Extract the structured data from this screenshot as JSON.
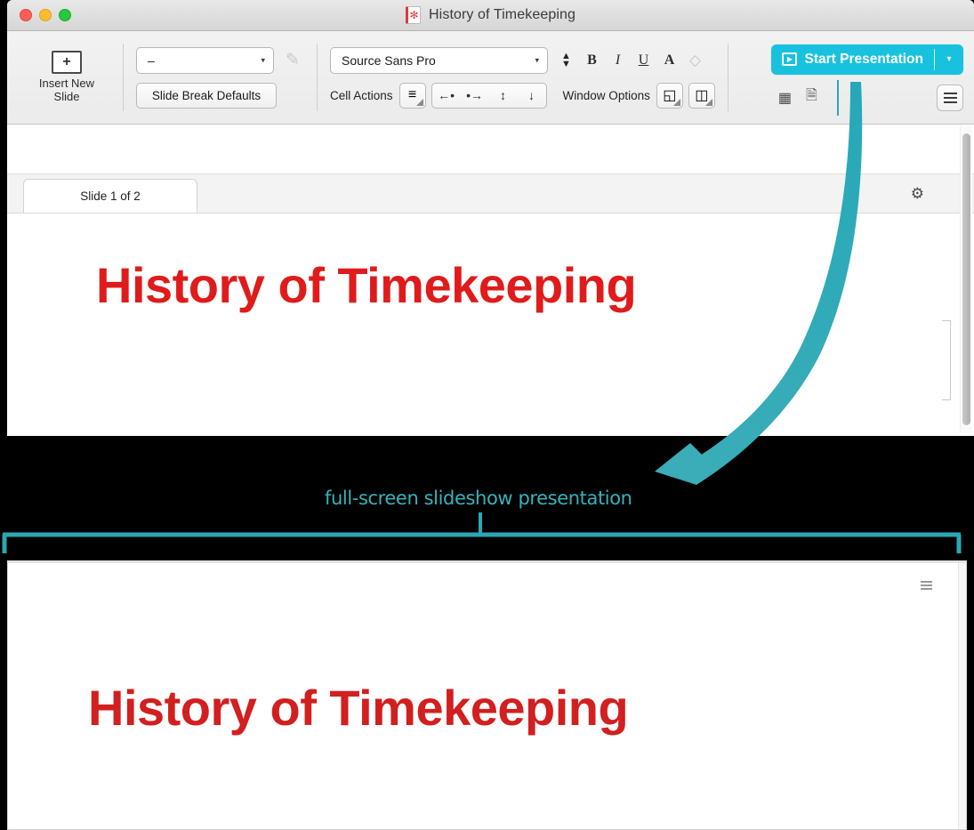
{
  "window": {
    "title": "History of Timekeeping",
    "doc_icon": "document-icon",
    "traffic_lights": {
      "close": "close-button",
      "minimize": "minimize-button",
      "maximize": "maximize-button"
    }
  },
  "toolbar": {
    "insert_slide": {
      "icon": "plus-in-slide-icon",
      "glyph": "+",
      "label_line1": "Insert New",
      "label_line2": "Slide"
    },
    "slide_break": {
      "select_value": "–",
      "caret": "▾",
      "pen_icon": "pen-strike-icon",
      "defaults_button": "Slide Break Defaults"
    },
    "format": {
      "font_value": "Source Sans Pro",
      "caret": "▾",
      "size_stepper": "size-stepper",
      "bold": "B",
      "italic": "I",
      "underline": "U",
      "text_color": "A",
      "clear_format": "◇"
    },
    "cell_actions": {
      "label": "Cell Actions",
      "align_icon": "align-left-icon",
      "buttons": [
        "←•",
        "•→",
        "↑",
        "↓"
      ]
    },
    "window_options": {
      "label": "Window Options",
      "fullscreen_icon": "fullscreen-icon",
      "split_icon": "split-view-icon"
    },
    "start_presentation": {
      "label": "Start Presentation",
      "play_icon": "play-icon",
      "glyph": "▶",
      "caret": "▾",
      "color": "#18c2de"
    },
    "secondary_icons": {
      "grid": "grid-view-icon",
      "notes": "presenter-notes-icon",
      "hamburger": "menu-icon"
    }
  },
  "tabbar": {
    "tab_label": "Slide 1 of 2",
    "gear_icon": "gear-icon",
    "gear_glyph": "⚙"
  },
  "canvas": {
    "slide_title": "History of Timekeeping",
    "title_color": "#e01b1b"
  },
  "annotation": {
    "text": "full-screen slideshow presentation",
    "color": "#35b3bd",
    "arrow": "curved-arrow",
    "bracket": "span-bracket"
  },
  "presentation": {
    "slide_title": "History of Timekeeping",
    "title_color": "#d21f1f",
    "menu_icon": "menu-icon"
  }
}
